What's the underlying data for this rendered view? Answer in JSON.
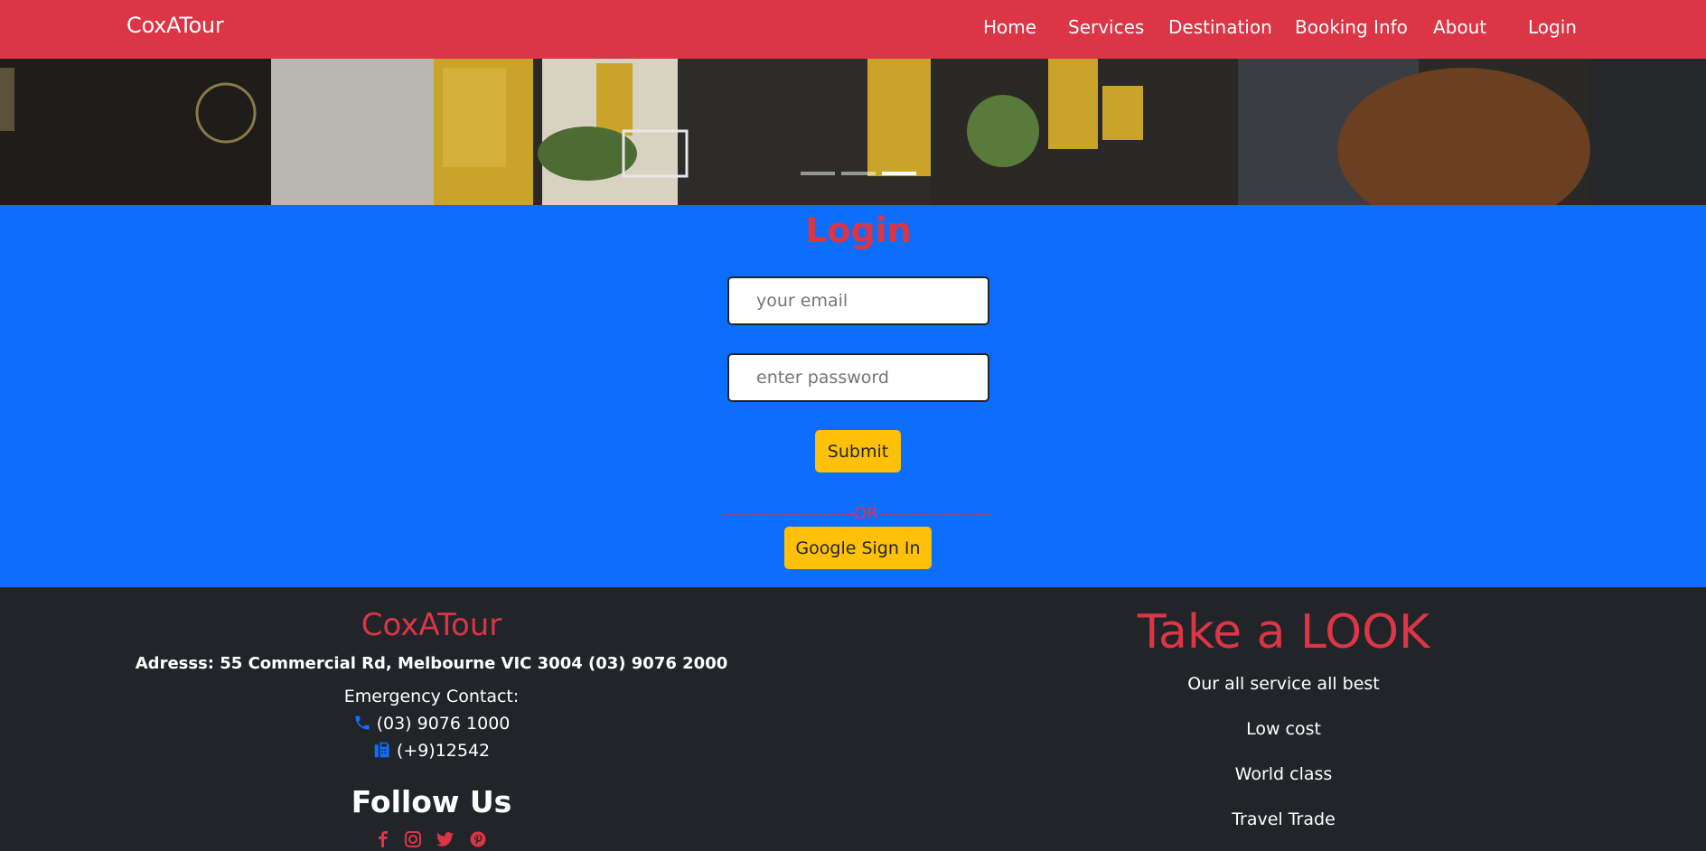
{
  "navbar": {
    "brand": "CoxATour",
    "links": [
      {
        "label": "Home"
      },
      {
        "label": "Services"
      },
      {
        "label": "Destination"
      },
      {
        "label": "Booking Info"
      },
      {
        "label": "About"
      },
      {
        "label": "Login"
      }
    ]
  },
  "hero": {
    "slides_total": 3,
    "active_slide": 3
  },
  "login": {
    "title": "Login",
    "email_placeholder": "your email",
    "password_placeholder": "enter password",
    "submit_label": "Submit",
    "divider_text": "OR",
    "google_label": "Google Sign In"
  },
  "footer": {
    "brand": "CoxATour",
    "address": "Adresss: 55 Commercial Rd, Melbourne VIC 3004 (03) 9076 2000",
    "emergency_label": "Emergency Contact:",
    "phone": "(03) 9076 1000",
    "fax": "(+9)12542",
    "follow_title": "Follow Us",
    "take_look_title": "Take a LOOK",
    "take_look_items": [
      "Our all service all best",
      "Low cost",
      "World class",
      "Travel Trade"
    ]
  },
  "colors": {
    "navbar": "#dc3545",
    "login_bg": "#0d6efd",
    "button": "#ffc107",
    "footer": "#212529",
    "accent_red": "#dc3545"
  },
  "icons": [
    "phone-icon",
    "fax-icon",
    "facebook-icon",
    "instagram-icon",
    "twitter-icon",
    "pinterest-icon"
  ]
}
